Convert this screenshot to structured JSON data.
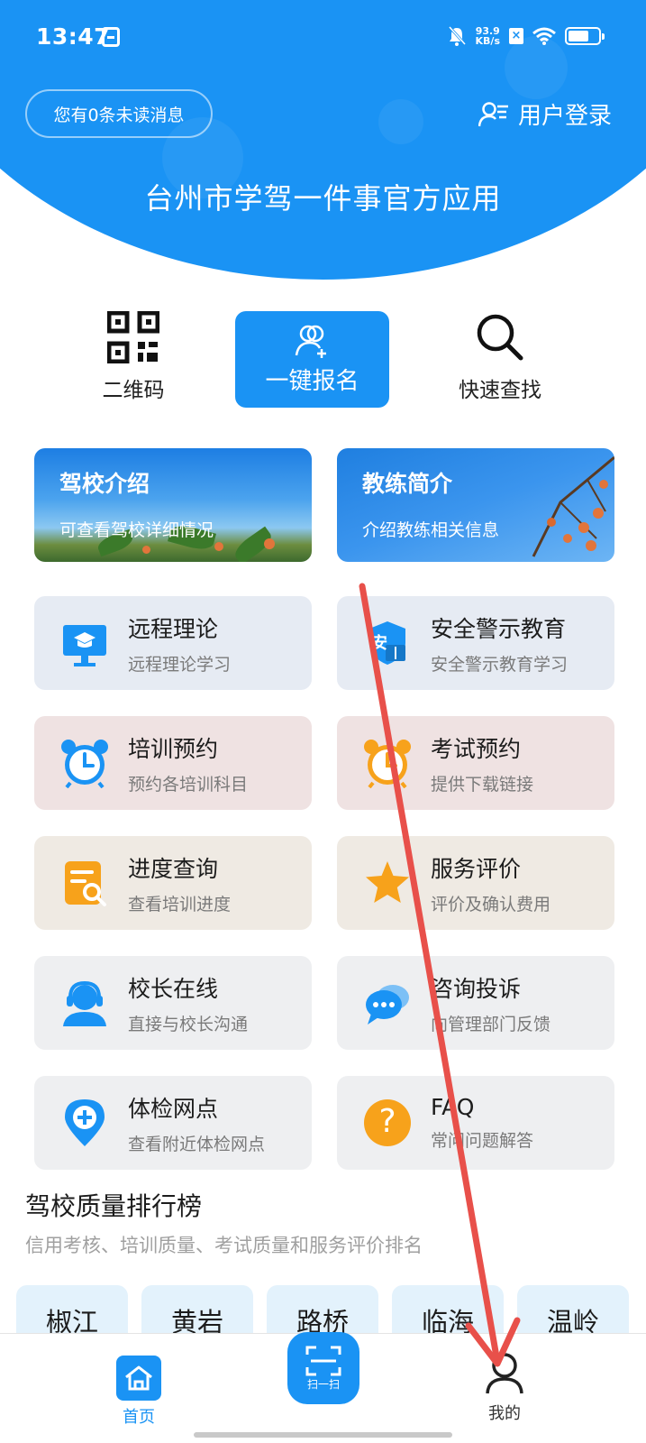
{
  "status_bar": {
    "time": "13:47",
    "net_speed_value": "93.9",
    "net_speed_unit": "KB/s",
    "sim_mark": "×"
  },
  "header": {
    "unread_messages": "您有0条未读消息",
    "login": "用户登录",
    "app_title": "台州市学驾一件事官方应用"
  },
  "quick_actions": {
    "qrcode": "二维码",
    "one_click_signup": "一键报名",
    "quick_search": "快速查找"
  },
  "banners": [
    {
      "title": "驾校介绍",
      "subtitle": "可查看驾校详细情况"
    },
    {
      "title": "教练简介",
      "subtitle": "介绍教练相关信息"
    }
  ],
  "services": [
    {
      "title": "远程理论",
      "subtitle": "远程理论学习",
      "icon": "remote-theory-icon"
    },
    {
      "title": "安全警示教育",
      "subtitle": "安全警示教育学习",
      "icon": "safety-shield-icon",
      "icon_text": "安"
    },
    {
      "title": "培训预约",
      "subtitle": "预约各培训科目",
      "icon": "alarm-clock-icon"
    },
    {
      "title": "考试预约",
      "subtitle": "提供下载链接",
      "icon": "alarm-clock-orange-icon"
    },
    {
      "title": "进度查询",
      "subtitle": "查看培训进度",
      "icon": "progress-search-icon"
    },
    {
      "title": "服务评价",
      "subtitle": "评价及确认费用",
      "icon": "star-icon"
    },
    {
      "title": "校长在线",
      "subtitle": "直接与校长沟通",
      "icon": "headset-person-icon"
    },
    {
      "title": "咨询投诉",
      "subtitle": "向管理部门反馈",
      "icon": "chat-bubble-icon"
    },
    {
      "title": "体检网点",
      "subtitle": "查看附近体检网点",
      "icon": "location-plus-icon"
    },
    {
      "title": "FAQ",
      "subtitle": "常问问题解答",
      "icon": "question-icon",
      "icon_text": "?"
    }
  ],
  "ranking": {
    "title": "驾校质量排行榜",
    "subtitle": "信用考核、培训质量、考试质量和服务评价排名",
    "tabs": [
      "椒江",
      "黄岩",
      "路桥",
      "临海",
      "温岭"
    ]
  },
  "bottom_nav": {
    "home": "首页",
    "scan": "扫一扫",
    "mine": "我的"
  },
  "colors": {
    "primary": "#1a93f4",
    "orange": "#f7a21b",
    "annotation": "#e8504a"
  }
}
